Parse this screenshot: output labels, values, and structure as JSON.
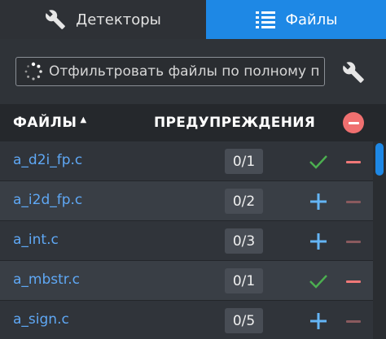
{
  "tabs": {
    "detectors": {
      "label": "Детекторы",
      "icon": "wrench-icon"
    },
    "files": {
      "label": "Файлы",
      "icon": "list-icon",
      "active": true
    }
  },
  "filter": {
    "placeholder": "Отфильтровать файлы по полному п",
    "value": ""
  },
  "table": {
    "headers": {
      "files": "ФАЙЛЫ",
      "sort_indicator": "ascending",
      "warnings": "ПРЕДУПРЕЖДЕНИЯ"
    },
    "rows": [
      {
        "name": "a_d2i_fp.c",
        "count": "0/1",
        "action": "check",
        "remove_active": true
      },
      {
        "name": "a_i2d_fp.c",
        "count": "0/2",
        "action": "add",
        "remove_active": false
      },
      {
        "name": "a_int.c",
        "count": "0/3",
        "action": "add",
        "remove_active": false
      },
      {
        "name": "a_mbstr.c",
        "count": "0/1",
        "action": "check",
        "remove_active": true
      },
      {
        "name": "a_sign.c",
        "count": "0/5",
        "action": "add",
        "remove_active": false
      }
    ]
  },
  "colors": {
    "accent": "#1e88e5",
    "link": "#5fa8f5",
    "check": "#4caf50",
    "add": "#64b5f6",
    "remove": "#f07878"
  }
}
